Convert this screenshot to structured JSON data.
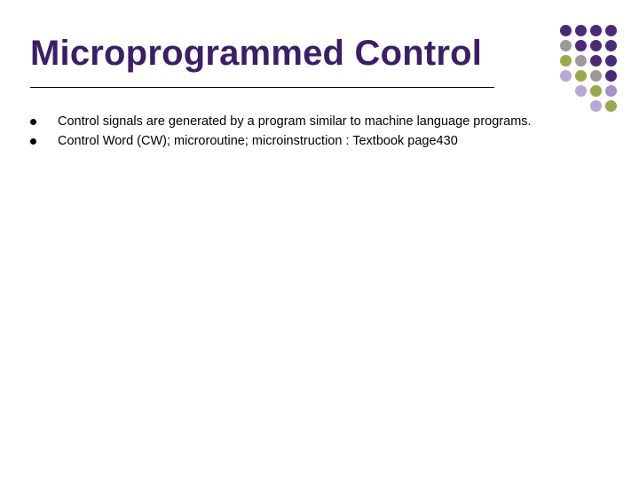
{
  "title": "Microprogrammed Control",
  "bullets": [
    "Control signals are generated by a program similar to machine language programs.",
    "Control Word (CW); microroutine; microinstruction  : Textbook page430"
  ]
}
